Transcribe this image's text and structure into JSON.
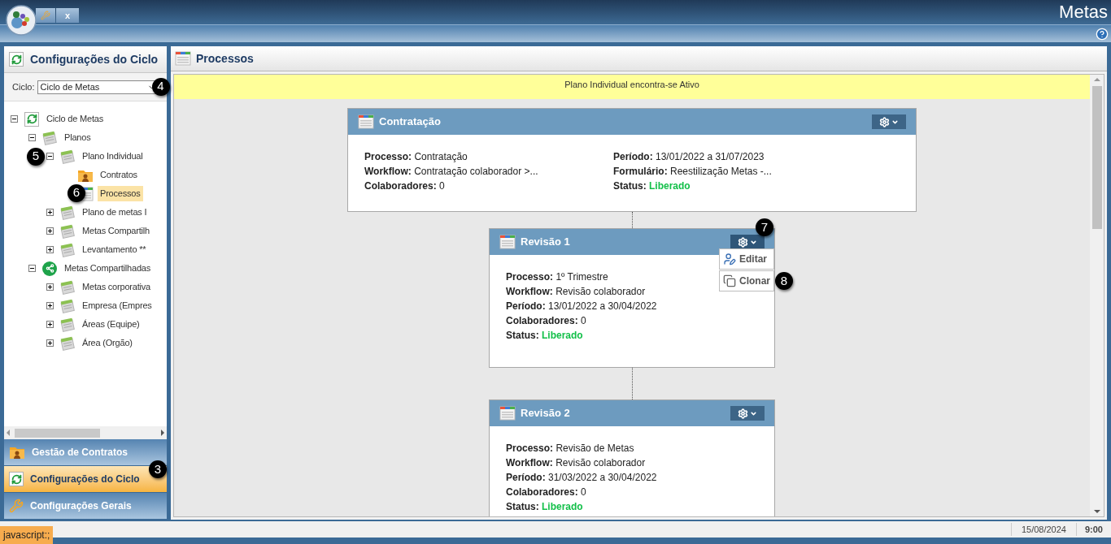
{
  "app": {
    "title": "Metas",
    "close_tab": "x"
  },
  "sidebar": {
    "title": "Configurações do Ciclo",
    "cycle_label": "Ciclo:",
    "cycle_value": "Ciclo de Metas",
    "cycle_callout": "4",
    "tree": [
      {
        "label": "Ciclo de Metas",
        "kind": "cycle",
        "expanded": true,
        "selected": false,
        "children": [
          {
            "label": "Planos",
            "kind": "plan",
            "expanded": true,
            "selected": false,
            "children": [
              {
                "label": "Plano Individual",
                "kind": "plan",
                "expanded": true,
                "selected": false,
                "callout": "5",
                "children": [
                  {
                    "label": "Contratos",
                    "kind": "folder",
                    "selected": false
                  },
                  {
                    "label": "Processos",
                    "kind": "process",
                    "selected": true,
                    "callout": "6"
                  }
                ]
              },
              {
                "label": "Plano de metas I",
                "kind": "plan",
                "expanded": false,
                "selected": false
              },
              {
                "label": "Metas Compartilh",
                "kind": "plan",
                "expanded": false,
                "selected": false
              },
              {
                "label": "Levantamento **",
                "kind": "plan",
                "expanded": false,
                "selected": false
              }
            ]
          },
          {
            "label": "Metas Compartilhadas",
            "kind": "share",
            "expanded": true,
            "selected": false,
            "children": [
              {
                "label": "Metas corporativa",
                "kind": "plan",
                "expanded": false,
                "selected": false
              },
              {
                "label": "Empresa (Empres",
                "kind": "plan",
                "expanded": false,
                "selected": false
              },
              {
                "label": "Áreas (Equipe)",
                "kind": "plan",
                "expanded": false,
                "selected": false
              },
              {
                "label": "Área (Orgão)",
                "kind": "plan",
                "expanded": false,
                "selected": false
              }
            ]
          }
        ]
      }
    ],
    "nav": [
      {
        "label": "Gestão de Contratos",
        "kind": "folder",
        "selected": false
      },
      {
        "label": "Configurações do Ciclo",
        "kind": "cycle",
        "selected": true,
        "callout": "3"
      },
      {
        "label": "Configurações Gerais",
        "kind": "wrench",
        "selected": false
      }
    ]
  },
  "main": {
    "title": "Processos",
    "banner": "Plano Individual encontra-se Ativo",
    "cards": [
      {
        "title": "Contratação",
        "menu_open": false,
        "columns": [
          [
            {
              "label": "Processo:",
              "value": "Contratação",
              "kind": "text"
            },
            {
              "label": "Workflow:",
              "value": "Contratação colaborador >...",
              "kind": "text"
            },
            {
              "label": "Colaboradores:",
              "value": "0",
              "kind": "text"
            }
          ],
          [
            {
              "label": "Período:",
              "value": "13/01/2022 a 31/07/2023",
              "kind": "text"
            },
            {
              "label": "Formulário:",
              "value": "Reestilização Metas -...",
              "kind": "text"
            },
            {
              "label": "Status:",
              "value": "Liberado",
              "kind": "status"
            }
          ]
        ]
      },
      {
        "title": "Revisão 1",
        "menu_open": true,
        "gear_callout": "7",
        "menu": [
          {
            "label": "Editar",
            "kind": "edit"
          },
          {
            "label": "Clonar",
            "kind": "clone",
            "callout": "8"
          }
        ],
        "columns": [
          [
            {
              "label": "Processo:",
              "value": "1º Trimestre",
              "kind": "text"
            },
            {
              "label": "Workflow:",
              "value": "Revisão colaborador",
              "kind": "text"
            },
            {
              "label": "Período:",
              "value": "13/01/2022 a 30/04/2022",
              "kind": "text"
            },
            {
              "label": "Colaboradores:",
              "value": "0",
              "kind": "text"
            },
            {
              "label": "Status:",
              "value": "Liberado",
              "kind": "status"
            }
          ]
        ]
      },
      {
        "title": "Revisão 2",
        "menu_open": false,
        "columns": [
          [
            {
              "label": "Processo:",
              "value": "Revisão de Metas",
              "kind": "text"
            },
            {
              "label": "Workflow:",
              "value": "Revisão colaborador",
              "kind": "text"
            },
            {
              "label": "Período:",
              "value": "31/03/2022 a 30/04/2022",
              "kind": "text"
            },
            {
              "label": "Colaboradores:",
              "value": "0",
              "kind": "text"
            },
            {
              "label": "Status:",
              "value": "Liberado",
              "kind": "status"
            }
          ]
        ]
      }
    ]
  },
  "status_bar": {
    "tooltip": "javascript:;",
    "date": "15/08/2024",
    "time": "9:00"
  }
}
